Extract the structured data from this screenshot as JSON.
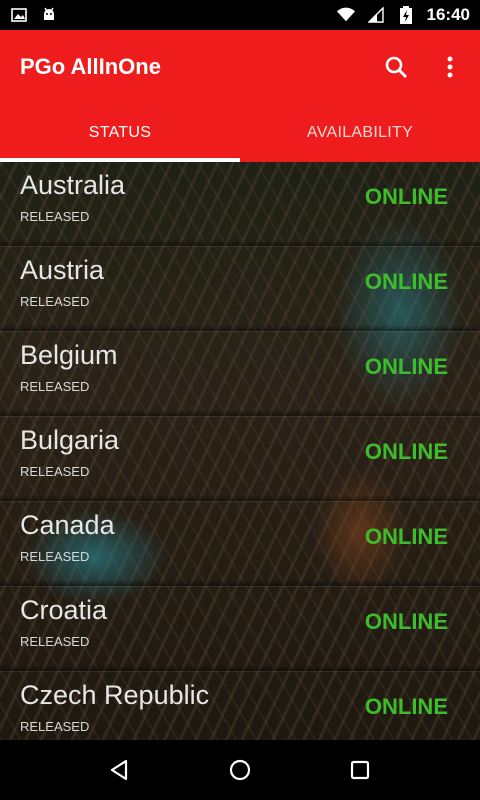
{
  "status_bar": {
    "time": "16:40",
    "icons": [
      "image-icon",
      "android-icon",
      "wifi-icon",
      "signal-icon",
      "battery-icon"
    ]
  },
  "app_bar": {
    "title": "PGo AllInOne",
    "actions": [
      "search-icon",
      "more-vert-icon"
    ]
  },
  "tabs": [
    {
      "label": "STATUS",
      "selected": true
    },
    {
      "label": "AVAILABILITY",
      "selected": false
    }
  ],
  "countries": [
    {
      "name": "Australia",
      "release": "RELEASED",
      "status": "ONLINE"
    },
    {
      "name": "Austria",
      "release": "RELEASED",
      "status": "ONLINE"
    },
    {
      "name": "Belgium",
      "release": "RELEASED",
      "status": "ONLINE"
    },
    {
      "name": "Bulgaria",
      "release": "RELEASED",
      "status": "ONLINE"
    },
    {
      "name": "Canada",
      "release": "RELEASED",
      "status": "ONLINE"
    },
    {
      "name": "Croatia",
      "release": "RELEASED",
      "status": "ONLINE"
    },
    {
      "name": "Czech Republic",
      "release": "RELEASED",
      "status": "ONLINE"
    }
  ],
  "colors": {
    "app_bar": "#ee1c1c",
    "online": "#3dbd2b"
  },
  "nav_bar": [
    "back-icon",
    "home-icon",
    "recents-icon"
  ]
}
